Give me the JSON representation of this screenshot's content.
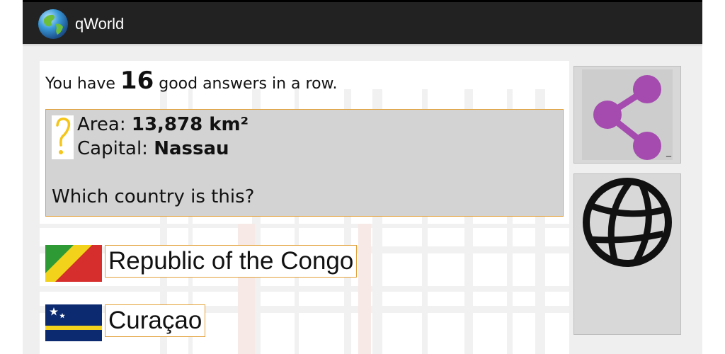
{
  "app": {
    "title": "qWorld",
    "icon": "globe-app-icon"
  },
  "streak": {
    "prefix": "You have",
    "count": "16",
    "suffix": "good answers in a row."
  },
  "question": {
    "area_label": "Area:",
    "area_value": "13,878 km²",
    "capital_label": "Capital:",
    "capital_value": "Nassau",
    "prompt": "Which country is this?",
    "icon": "question-mark-icon"
  },
  "answers": [
    {
      "label": "Republic of the Congo",
      "flag": "congo-flag"
    },
    {
      "label": "Curaçao",
      "flag": "curacao-flag"
    }
  ],
  "side": {
    "share_icon": "share-icon",
    "globe_icon": "globe-icon",
    "share_mark": "_"
  },
  "colors": {
    "actionbar": "#222222",
    "accent_border": "#e3a13b",
    "share": "#a54bb0",
    "question_bg": "#d3d3d3"
  }
}
